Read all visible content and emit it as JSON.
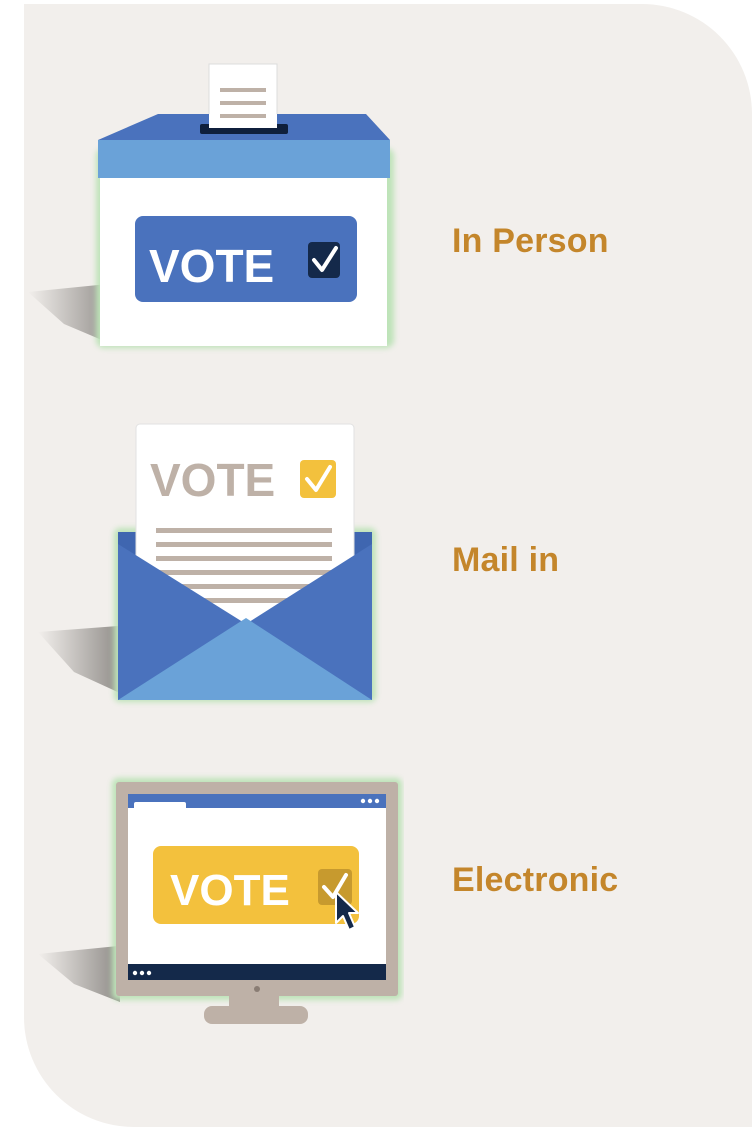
{
  "methods": [
    {
      "label": "In Person",
      "icon": "ballot-box-icon",
      "badge_text": "VOTE"
    },
    {
      "label": "Mail in",
      "icon": "mail-ballot-icon",
      "badge_text": "VOTE"
    },
    {
      "label": "Electronic",
      "icon": "computer-vote-icon",
      "badge_text": "VOTE"
    }
  ],
  "colors": {
    "panel": "#f2efec",
    "label": "#c4862b",
    "blue_dark": "#4a72bd",
    "blue_light": "#6aa2d8",
    "navy": "#14294a",
    "gold": "#f3c13d",
    "taupe": "#beb1a7"
  }
}
